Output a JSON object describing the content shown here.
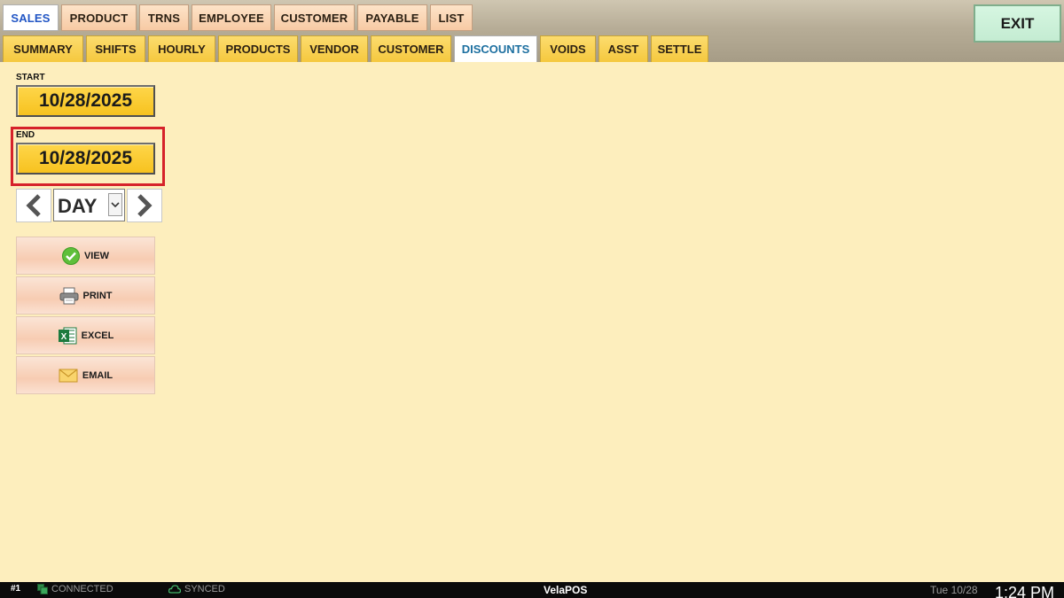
{
  "top_tabs": [
    {
      "label": "SALES",
      "active": true
    },
    {
      "label": "PRODUCT",
      "active": false
    },
    {
      "label": "TRNS",
      "active": false
    },
    {
      "label": "EMPLOYEE",
      "active": false
    },
    {
      "label": "CUSTOMER",
      "active": false
    },
    {
      "label": "PAYABLE",
      "active": false
    },
    {
      "label": "LIST",
      "active": false
    }
  ],
  "sub_tabs": [
    {
      "label": "SUMMARY",
      "active": false
    },
    {
      "label": "SHIFTS",
      "active": false
    },
    {
      "label": "HOURLY",
      "active": false
    },
    {
      "label": "PRODUCTS",
      "active": false
    },
    {
      "label": "VENDOR",
      "active": false
    },
    {
      "label": "CUSTOMER",
      "active": false
    },
    {
      "label": "DISCOUNTS",
      "active": true
    },
    {
      "label": "VOIDS",
      "active": false
    },
    {
      "label": "ASST",
      "active": false
    },
    {
      "label": "SETTLE",
      "active": false
    }
  ],
  "exit_label": "EXIT",
  "start": {
    "label": "START",
    "value": "10/28/2025"
  },
  "end": {
    "label": "END",
    "value": "10/28/2025"
  },
  "period": {
    "selected": "DAY"
  },
  "actions": {
    "view": "VIEW",
    "print": "PRINT",
    "excel": "EXCEL",
    "email": "EMAIL"
  },
  "statusbar": {
    "station": "#1",
    "connection": "CONNECTED",
    "sync": "SYNCED",
    "brand": "VelaPOS",
    "date": "Tue 10/28",
    "time": "1:24 PM"
  },
  "colors": {
    "background": "#fdeebd",
    "highlight": "#d6222a",
    "date_button": "#f7c21f"
  }
}
